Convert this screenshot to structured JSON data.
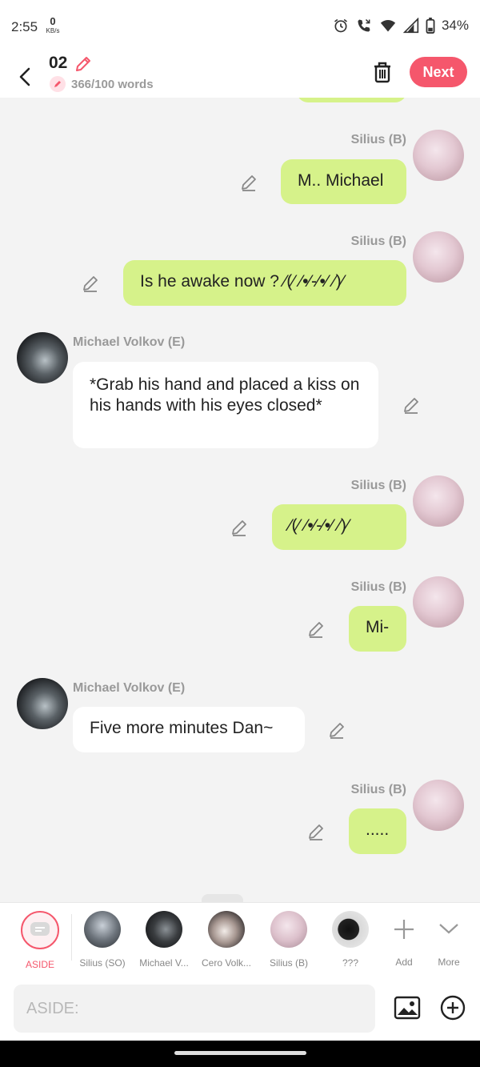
{
  "status_bar": {
    "time": "2:55",
    "net_speed": "0",
    "net_unit": "KB/s",
    "battery": "34%"
  },
  "header": {
    "title": "02",
    "word_count": "366/100 words",
    "next_label": "Next"
  },
  "messages": [
    {
      "side": "me",
      "name": "Silius (B)",
      "text": "M.. Michael"
    },
    {
      "side": "me",
      "name": "Silius (B)",
      "text": "Is he awake now ? ⁄(⁄ ⁄•⁄-⁄•⁄ ⁄)⁄"
    },
    {
      "side": "them",
      "name": "Michael Volkov (E)",
      "text": "*Grab his hand and placed a kiss on his hands with his eyes closed*"
    },
    {
      "side": "me",
      "name": "Silius (B)",
      "text": "⁄(⁄ ⁄•⁄-⁄•⁄ ⁄)⁄"
    },
    {
      "side": "me",
      "name": "Silius (B)",
      "text": "Mi-"
    },
    {
      "side": "them",
      "name": "Michael Volkov (E)",
      "text": "Five more minutes Dan~"
    },
    {
      "side": "me",
      "name": "Silius (B)",
      "text": "....."
    }
  ],
  "characters": [
    {
      "label": "ASIDE",
      "icon": "chat-bubble-icon",
      "selected": true
    },
    {
      "label": "Silius (SO)"
    },
    {
      "label": "Michael V..."
    },
    {
      "label": "Cero Volk..."
    },
    {
      "label": "Silius (B)"
    },
    {
      "label": "???"
    },
    {
      "label": "Add",
      "icon": "plus-icon"
    },
    {
      "label": "More",
      "icon": "chevron-down-icon"
    }
  ],
  "input": {
    "placeholder": "ASIDE:"
  },
  "colors": {
    "accent": "#f5576c",
    "my_bubble": "#d6f28a",
    "their_bubble": "#ffffff",
    "background": "#f3f3f3"
  }
}
